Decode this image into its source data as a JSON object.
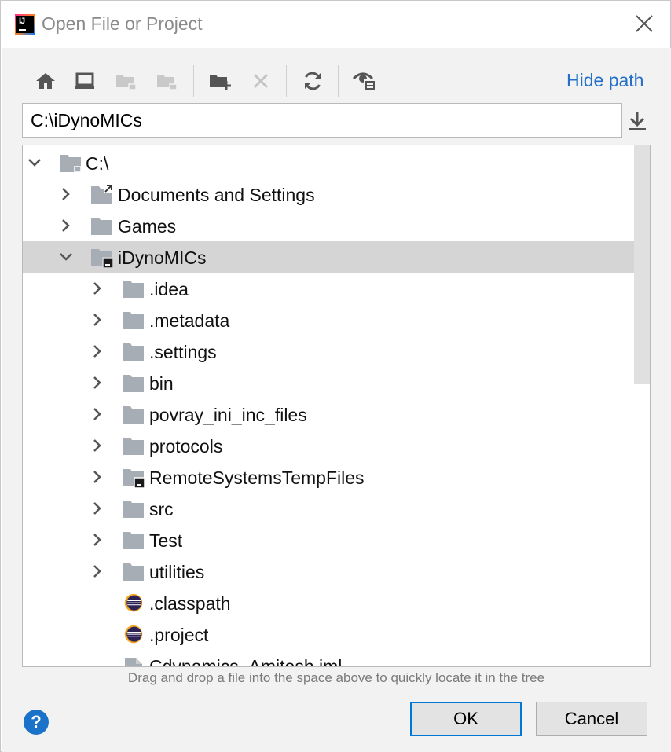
{
  "window": {
    "title": "Open File or Project"
  },
  "toolbar": {
    "buttons": [
      "home-icon",
      "desktop-icon",
      "project-folder-icon",
      "module-folder-icon",
      "new-folder-icon",
      "delete-icon",
      "refresh-icon",
      "show-hidden-icon"
    ],
    "hide_path_label": "Hide path"
  },
  "path": {
    "value": "C:\\iDynoMICs"
  },
  "tree": {
    "rows": [
      {
        "label": "C:\\",
        "expanded": true
      },
      {
        "label": "Documents and Settings",
        "expanded": false
      },
      {
        "label": "Games",
        "expanded": false
      },
      {
        "label": "iDynoMICs",
        "expanded": true,
        "selected": true
      },
      {
        "label": ".idea"
      },
      {
        "label": ".metadata"
      },
      {
        "label": ".settings"
      },
      {
        "label": "bin"
      },
      {
        "label": "povray_ini_inc_files"
      },
      {
        "label": "protocols"
      },
      {
        "label": "RemoteSystemsTempFiles"
      },
      {
        "label": "src"
      },
      {
        "label": "Test"
      },
      {
        "label": "utilities"
      },
      {
        "label": ".classpath"
      },
      {
        "label": ".project"
      },
      {
        "label": "Cdynamics_Amitesh.iml"
      }
    ]
  },
  "hint": "Drag and drop a file into the space above to quickly locate it in the tree",
  "buttons": {
    "help": "?",
    "ok": "OK",
    "cancel": "Cancel"
  },
  "colors": {
    "accent": "#2470c8",
    "folder": "#a7adb4",
    "selection": "#d5d5d5"
  }
}
